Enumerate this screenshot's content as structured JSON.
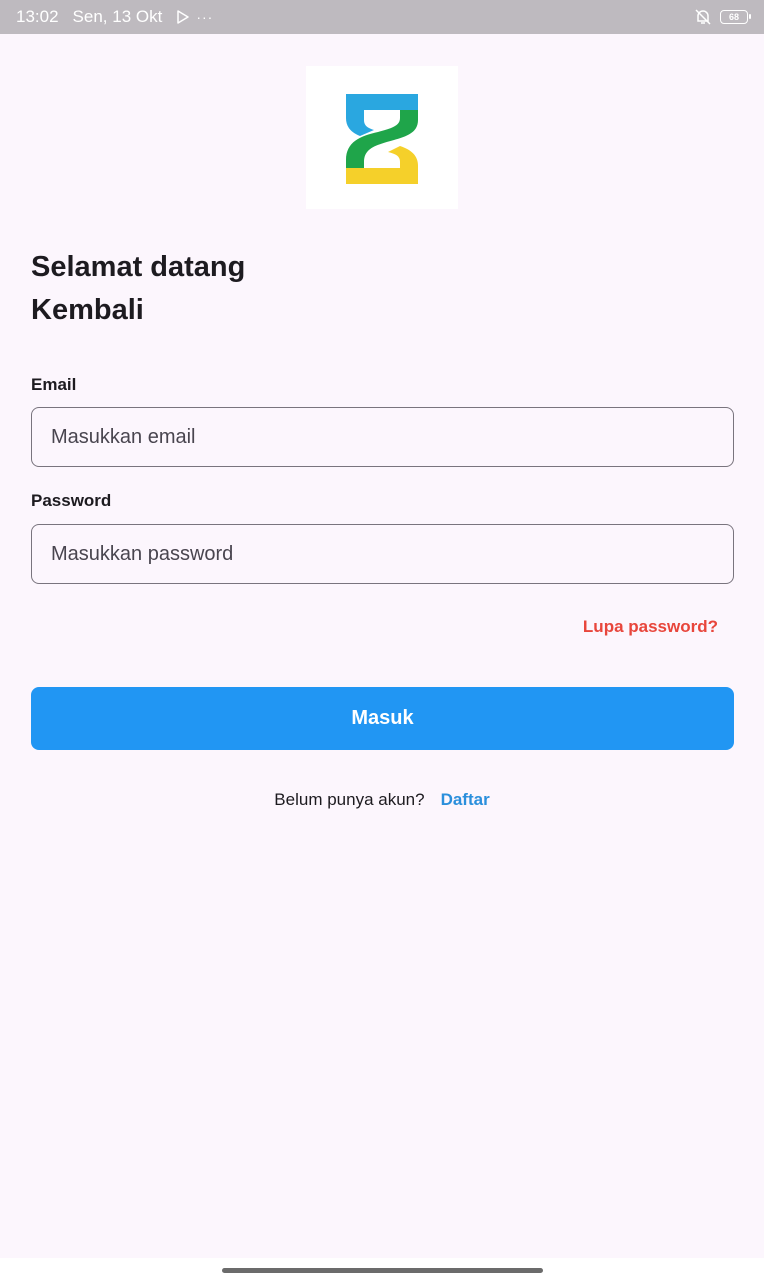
{
  "status_bar": {
    "time": "13:02",
    "date": "Sen, 13 Okt",
    "more": "···",
    "battery": "68"
  },
  "logo": {
    "icon": "hourglass-logo-icon",
    "colors": [
      "#2aa7e0",
      "#1fa54a",
      "#f5d02a"
    ]
  },
  "welcome": {
    "line1": "Selamat datang",
    "line2": "Kembali"
  },
  "email": {
    "label": "Email",
    "placeholder": "Masukkan email",
    "value": ""
  },
  "password": {
    "label": "Password",
    "placeholder": "Masukkan password",
    "value": ""
  },
  "forgot_password": "Lupa password?",
  "login_button": "Masuk",
  "register": {
    "prompt": "Belum punya akun?",
    "link": "Daftar"
  },
  "colors": {
    "primary": "#2196f3",
    "danger": "#e8463c",
    "link": "#2a8fdc",
    "background": "#fcf6fd"
  }
}
